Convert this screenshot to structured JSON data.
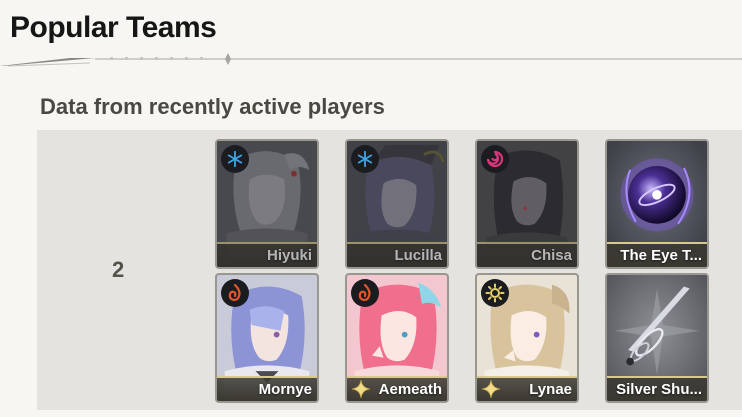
{
  "header": {
    "title": "Popular Teams"
  },
  "section": {
    "subtitle": "Data from recently active players"
  },
  "team": {
    "rank": "2",
    "cards": [
      {
        "name": "Hiyuki",
        "element": "glacio",
        "owned": false
      },
      {
        "name": "Lucilla",
        "element": "glacio",
        "owned": false
      },
      {
        "name": "Chisa",
        "element": "havoc",
        "owned": false
      },
      {
        "name": "The Eye T...",
        "element": "none",
        "owned": true
      },
      {
        "name": "Mornye",
        "element": "fusion",
        "owned": true
      },
      {
        "name": "Aemeath",
        "element": "fusion",
        "owned": true,
        "five_star": true
      },
      {
        "name": "Lynae",
        "element": "spectro",
        "owned": true,
        "five_star": true
      },
      {
        "name": "Silver Shu...",
        "element": "none",
        "owned": true
      }
    ]
  },
  "colors": {
    "glacio": "#3fa4e6",
    "havoc": "#d8367a",
    "fusion": "#e2552b",
    "spectro": "#e4cf62",
    "nameplate_trim": "#d9c98e"
  }
}
